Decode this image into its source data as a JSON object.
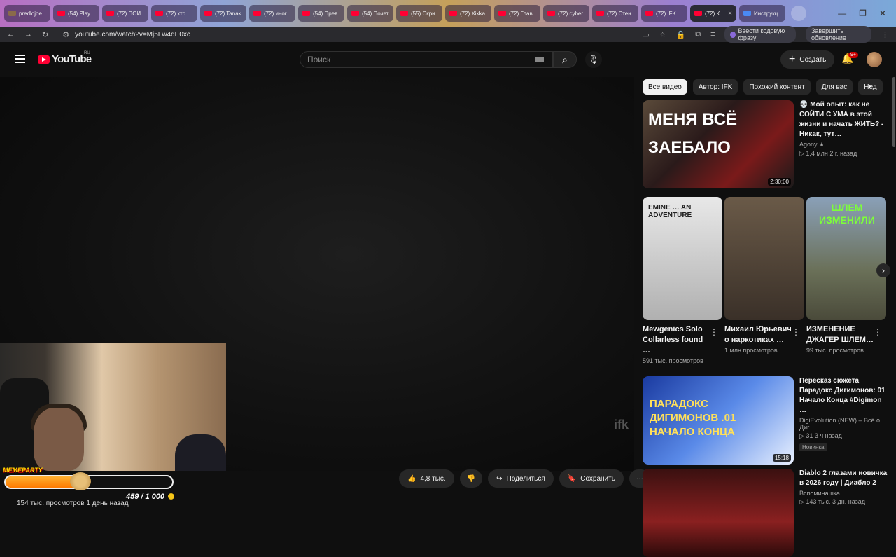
{
  "tabs": [
    {
      "label": "predlojoe",
      "type": "img"
    },
    {
      "label": "(54) Play",
      "type": "yt"
    },
    {
      "label": "(72) ПОИ",
      "type": "yt"
    },
    {
      "label": "(72) кто",
      "type": "yt"
    },
    {
      "label": "(72) Tanak",
      "type": "yt"
    },
    {
      "label": "(72) иног",
      "type": "yt"
    },
    {
      "label": "(54) Прев",
      "type": "yt"
    },
    {
      "label": "(54) Почет",
      "type": "yt"
    },
    {
      "label": "(55) Скри",
      "type": "yt"
    },
    {
      "label": "(72) Xikka",
      "type": "yt"
    },
    {
      "label": "(72) Глав",
      "type": "yt"
    },
    {
      "label": "(72) cyber",
      "type": "yt"
    },
    {
      "label": "(72) Стен",
      "type": "yt"
    },
    {
      "label": "(72) IFK",
      "type": "yt"
    },
    {
      "label": "(72) К",
      "type": "yt",
      "active": true
    },
    {
      "label": "Инструкц",
      "type": "doc"
    }
  ],
  "browser": {
    "url": "youtube.com/watch?v=Mj5Lw4qE0xc",
    "passphrase_label": "Ввести кодовую фразу",
    "finish_update_label": "Завершить обновление"
  },
  "header": {
    "logo_text": "YouTube",
    "region": "RU",
    "search_placeholder": "Поиск",
    "create_label": "Создать",
    "notif_count": "9+"
  },
  "player": {
    "watermark": "ifk"
  },
  "overlay": {
    "party_label": "MEMEPARTY",
    "progress": 0.459,
    "count_label": "459 / 1 000"
  },
  "video_meta": {
    "views": "154 тыс. просмотров  1 день назад",
    "likes": "4,8 тыс.",
    "share_label": "Поделиться",
    "save_label": "Сохранить"
  },
  "chips": [
    "Все видео",
    "Автор: IFK",
    "Похожий контент",
    "Для вас",
    "Нед"
  ],
  "recommendations": [
    {
      "title": "💀 Мой опыт: как не СОЙТИ С УМА в этой жизни и начать ЖИТЬ? - Никак, тут…",
      "channel": "Agony ★",
      "meta": "▷ 1,4 млн  2 г. назад",
      "duration": "2:30:00",
      "thumb_text": "МЕНЯ ВСЁ ЗАЕБАЛО"
    },
    {
      "title": "Пересказ сюжета Парадокс Дигимонов: 01 Начало Конца #Digimon …",
      "channel": "DigiEvolution (NEW) – Всё о Диг…",
      "meta": "▷ 31  3 ч назад",
      "badge": "Новинка",
      "duration": "15:18",
      "thumb_text": "ПАРАДОКС ДИГИМОНОВ .01 НАЧАЛО КОНЦА"
    },
    {
      "title": "Diablo 2 глазами новичка в 2026 году | Диабло 2",
      "channel": "Вспоминашка",
      "meta": "▷ 143 тыс.  3 дн. назад",
      "duration": "",
      "thumb_text": ""
    }
  ],
  "shorts": [
    {
      "title": "Mewgenics Solo Collarless found …",
      "meta": "591 тыс. просмотров",
      "thumb_text": "EMINE … AN ADVENTURE"
    },
    {
      "title": "Михаил Юрьевич о наркотиках …",
      "meta": "1 млн просмотров",
      "thumb_text": ""
    },
    {
      "title": "ИЗМЕНЕНИЕ ДЖАГЕР ШЛЕМ…",
      "meta": "99 тыс. просмотров",
      "thumb_text": "ШЛЕМ ИЗМЕНИЛИ"
    }
  ]
}
